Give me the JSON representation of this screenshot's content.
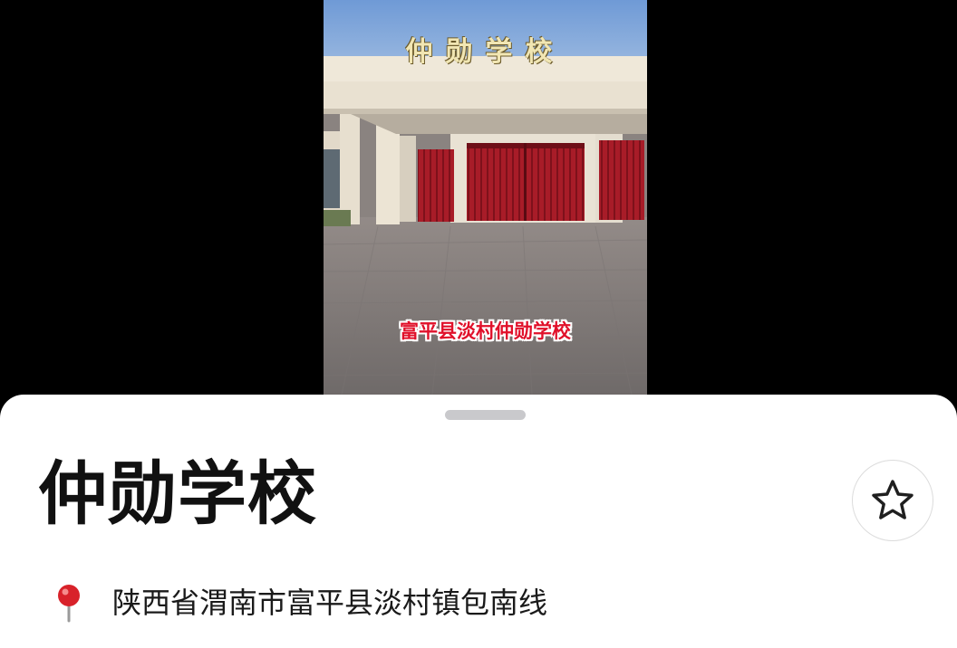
{
  "video": {
    "sign_text": "仲勋学校",
    "caption": "富平县淡村仲勋学校"
  },
  "place": {
    "name": "仲勋学校",
    "address": "陕西省渭南市富平县淡村镇包南线"
  },
  "icons": {
    "favorite": "star-outline-icon",
    "location": "location-pin-icon"
  }
}
